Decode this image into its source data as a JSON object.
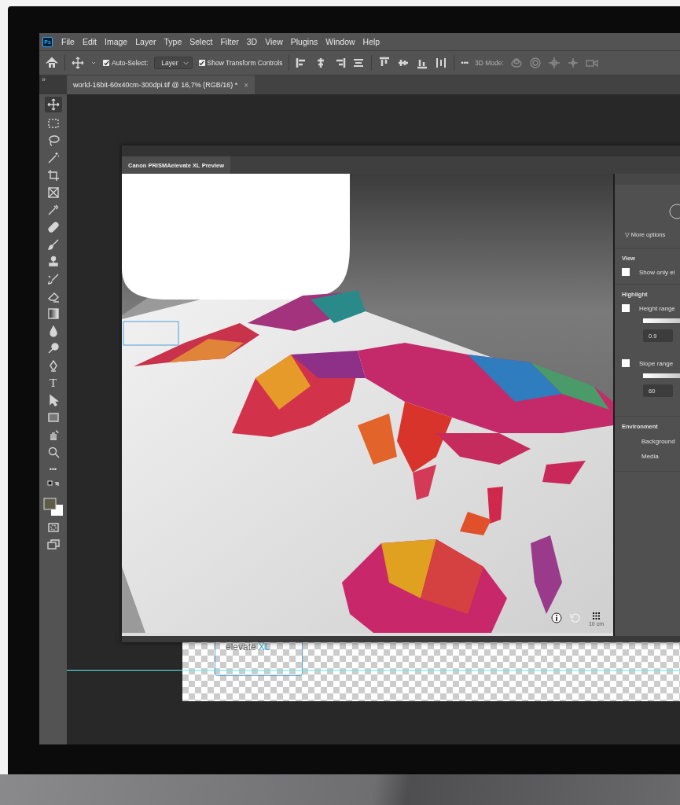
{
  "menu": [
    {
      "label": "File"
    },
    {
      "label": "Edit"
    },
    {
      "label": "Image"
    },
    {
      "label": "Layer"
    },
    {
      "label": "Type"
    },
    {
      "label": "Select"
    },
    {
      "label": "Filter"
    },
    {
      "label": "3D"
    },
    {
      "label": "View"
    },
    {
      "label": "Plugins"
    },
    {
      "label": "Window"
    },
    {
      "label": "Help"
    }
  ],
  "app_badge": "Ps",
  "options_bar": {
    "auto_select": {
      "label": "Auto-Select:",
      "checked": true
    },
    "layer_dropdown": "Layer",
    "transform_controls": {
      "label": "Show Transform Controls",
      "checked": true
    },
    "more": "•••",
    "mode_label": "3D Mode:"
  },
  "panel_toggle": "»",
  "document_tab": {
    "title": "world-16bit-60x40cm-300dpi.tif @ 16,7% (RGB/16) *",
    "close": "×"
  },
  "toolbar": {
    "type_tool": "T",
    "more": "•••"
  },
  "plugin_window": {
    "tab": "Canon PRISMAelevate XL Preview",
    "scale_label": "10 cm",
    "more_options": "▽ More options",
    "sections": [
      {
        "title": "View",
        "items": [
          {
            "kind": "checkbox",
            "label": "Show only el",
            "checked": false
          }
        ]
      },
      {
        "title": "Highlight",
        "items": [
          {
            "kind": "checkbox",
            "label": "Height range",
            "checked": false
          },
          {
            "kind": "slider",
            "level": 1
          },
          {
            "kind": "field",
            "value": "0.9"
          },
          {
            "kind": "checkbox",
            "label": "Slope range",
            "checked": false
          },
          {
            "kind": "slider",
            "level": 1
          },
          {
            "kind": "field",
            "value": "60"
          }
        ]
      },
      {
        "title": "Environment",
        "items": [
          {
            "kind": "text",
            "label": "Background"
          },
          {
            "kind": "text",
            "label": "Media"
          }
        ]
      }
    ]
  },
  "document": {
    "logo_word": "elevate",
    "logo_accent": "XL"
  }
}
